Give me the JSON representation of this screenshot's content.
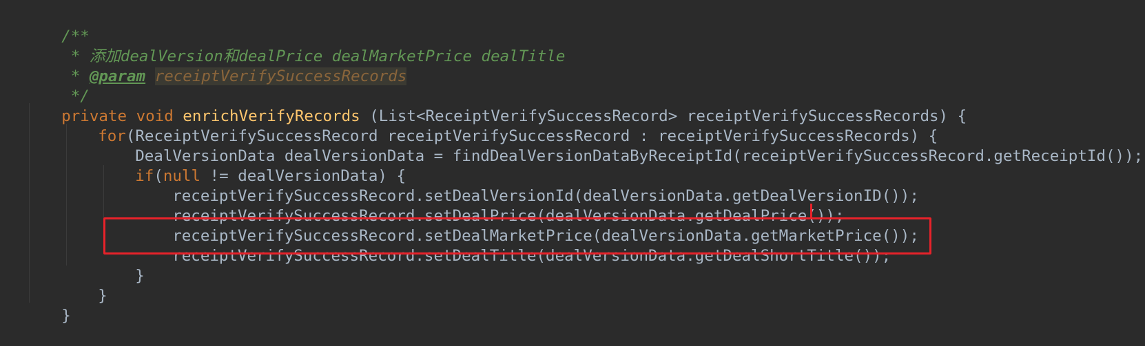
{
  "code": {
    "doc_open": "/**",
    "doc_line1_prefix": " * ",
    "doc_line1_text": "添加dealVersion和dealPrice dealMarketPrice dealTitle",
    "doc_line2_prefix": " * ",
    "doc_line2_tag": "@param",
    "doc_line2_param": "receiptVerifySuccessRecords",
    "doc_close": " */",
    "sig_private": "private",
    "sig_void": "void",
    "sig_name": "enrichVerifyRecords",
    "sig_rest": " (List<ReceiptVerifySuccessRecord> receiptVerifySuccessRecords) {",
    "for_kw": "for",
    "for_rest": "(ReceiptVerifySuccessRecord receiptVerifySuccessRecord : receiptVerifySuccessRecords) {",
    "decl_line": "DealVersionData dealVersionData = findDealVersionDataByReceiptId(receiptVerifySuccessRecord.getReceiptId());",
    "if_kw": "if",
    "if_open": "(",
    "if_null": "null",
    "if_rest": " != dealVersionData) {",
    "set_line1": "receiptVerifySuccessRecord.setDealVersionId(dealVersionData.getDealVersionID());",
    "set_line2": "receiptVerifySuccessRecord.setDealPrice(dealVersionData.getDealPrice());",
    "set_line3": "receiptVerifySuccessRecord.setDealMarketPrice(dealVersionData.getMarketPrice());",
    "set_line4": "receiptVerifySuccessRecord.setDealTitle(dealVersionData.getDealShortTitle());",
    "close_if": "}",
    "close_for": "}",
    "close_method": "}"
  },
  "colors": {
    "background": "#2b2b2b",
    "comment": "#629755",
    "keyword": "#cc7832",
    "method_name": "#ffc66d",
    "text": "#a9b7c6",
    "highlight_box": "#e8222a"
  }
}
